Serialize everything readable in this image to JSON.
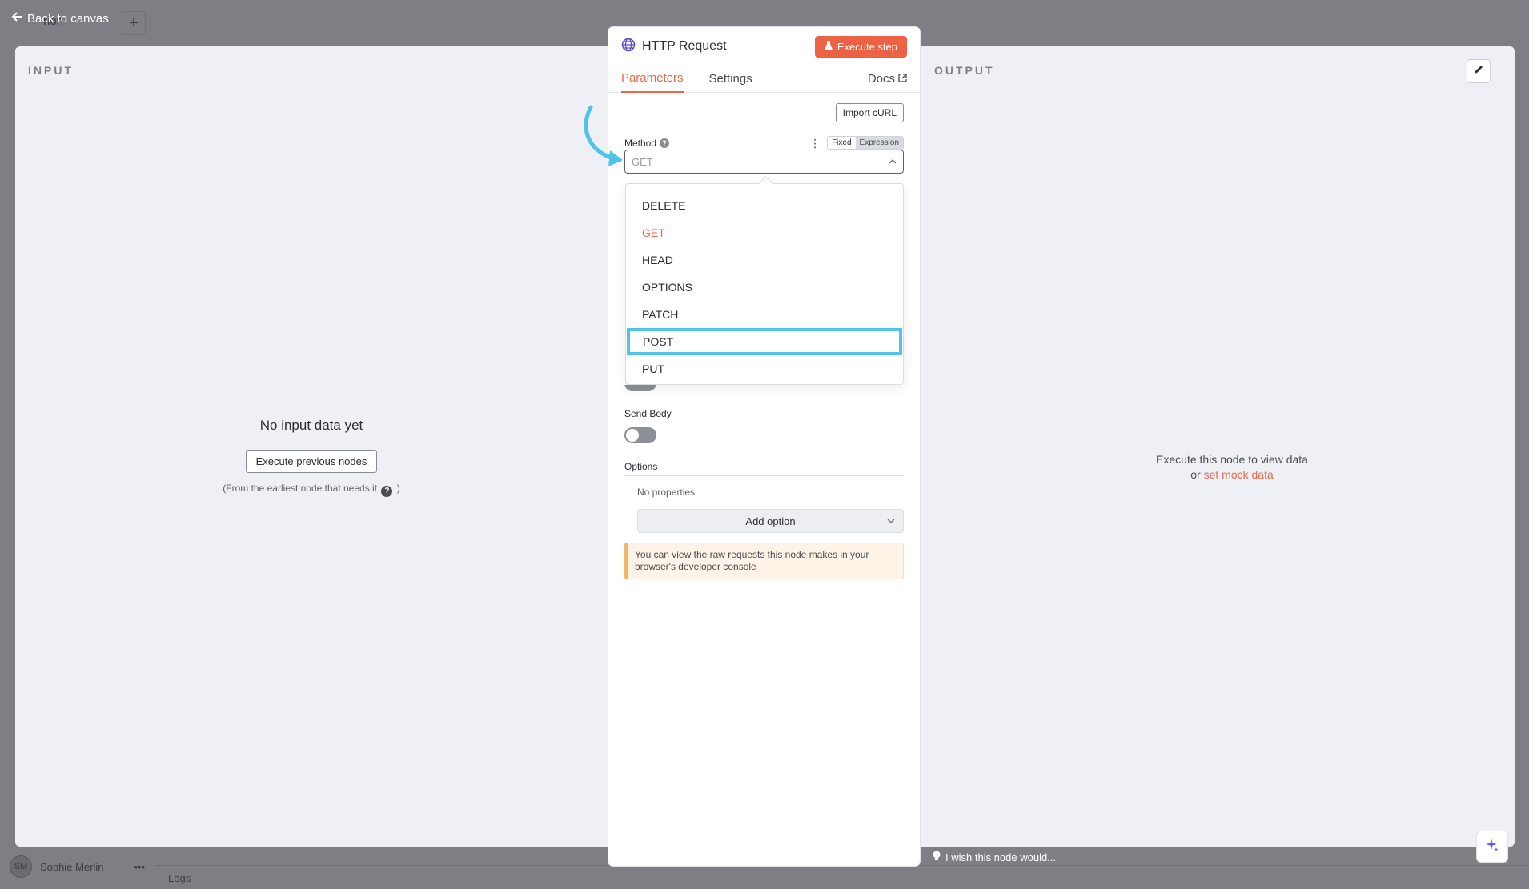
{
  "background": {
    "ghost_title": "rion",
    "plus_label": "+",
    "user_initials": "SM",
    "user_name": "Sophie Merlin",
    "more_label": "•••",
    "logs_label": "Logs"
  },
  "back_link": "Back to canvas",
  "input_panel": {
    "title": "INPUT",
    "empty_title": "No input data yet",
    "execute_button": "Execute previous nodes",
    "note_prefix": "(From the earliest node that needs it",
    "note_suffix": ")"
  },
  "output_panel": {
    "title": "OUTPUT",
    "line1": "Execute this node to view data",
    "line2_prefix": "or",
    "line2_link": "set mock data"
  },
  "node": {
    "title": "HTTP Request",
    "execute_step": "Execute step",
    "tabs": [
      "Parameters",
      "Settings"
    ],
    "docs_label": "Docs",
    "import_curl": "Import cURL",
    "method_label": "Method",
    "mode_fixed": "Fixed",
    "mode_expression": "Expression",
    "method_placeholder": "GET",
    "send_body_label": "Send Body",
    "options_label": "Options",
    "no_properties": "No properties",
    "add_option": "Add option",
    "notice": "You can view the raw requests this node makes in your browser's developer console"
  },
  "method_options": [
    {
      "label": "DELETE"
    },
    {
      "label": "GET"
    },
    {
      "label": "HEAD"
    },
    {
      "label": "OPTIONS"
    },
    {
      "label": "PATCH"
    },
    {
      "label": "POST"
    },
    {
      "label": "PUT"
    }
  ],
  "selected_method": "GET",
  "highlighted_method": "POST",
  "feedback": "I wish this node would...",
  "colors": {
    "accent": "#e8694a",
    "execute_bg": "#ec6244",
    "highlight": "#4fc3e8"
  }
}
